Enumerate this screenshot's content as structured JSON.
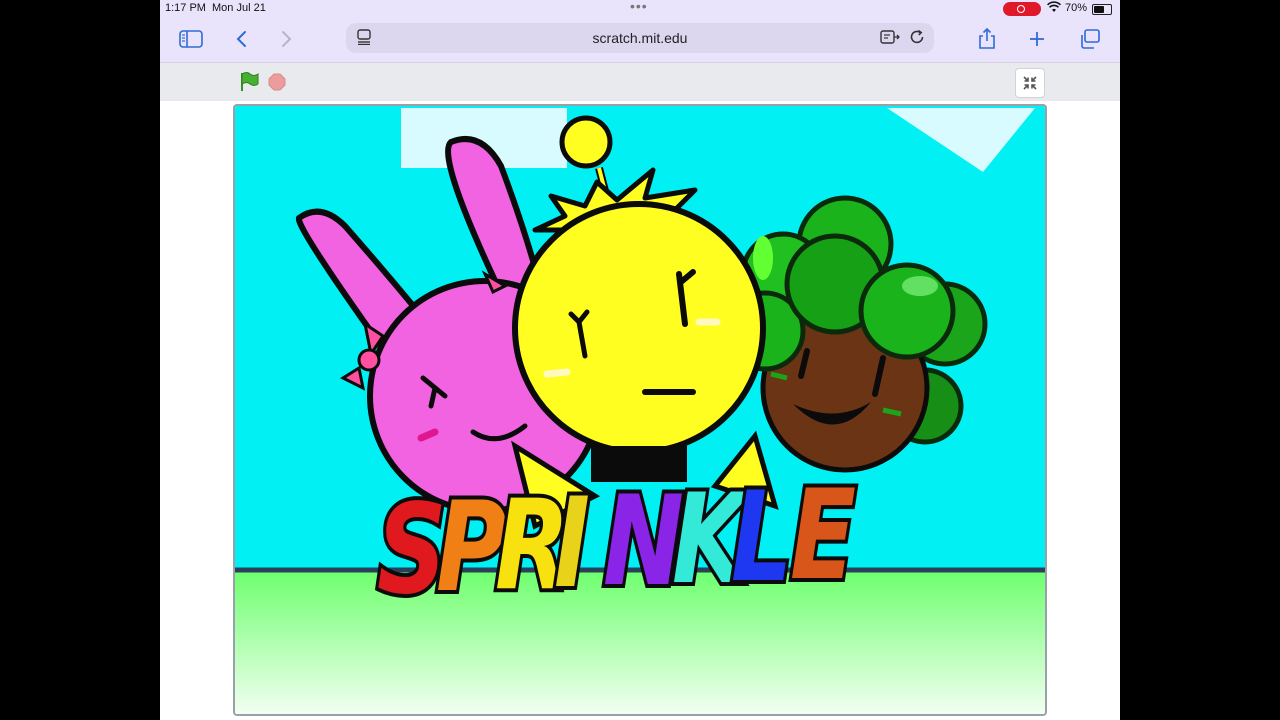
{
  "status_bar": {
    "time": "1:17 PM",
    "date": "Mon Jul 21",
    "battery_percent": "70%",
    "battery_level": 0.7
  },
  "browser": {
    "url": "scratch.mit.edu"
  },
  "stage": {
    "title_text": "SPRINKLE",
    "letter_colors": [
      "#e0191e",
      "#f07f15",
      "#f7e20f",
      "#e8d21a",
      "#8a24e6",
      "#33ead9",
      "#1d38f0",
      "#d9561a",
      "#c572ee"
    ],
    "colors": {
      "sky": "#00f0f3",
      "ground_top": "#6bff6b",
      "ground_bottom": "#f2fff2",
      "pink": "#f163e0",
      "yellow": "#fffe20",
      "green": "#1bb31b",
      "brown": "#6b3414"
    }
  },
  "icons": {
    "sidebar": "sidebar-icon",
    "back": "chevron-left-icon",
    "forward": "chevron-right-icon",
    "tabs": "tab-overview-icon",
    "reader": "reader-icon",
    "reload": "reload-icon",
    "share": "share-icon",
    "new_tab": "plus-icon",
    "all_tabs": "tabs-icon",
    "green_flag": "green-flag-icon",
    "stop": "stop-icon",
    "exit_fullscreen": "exit-fullscreen-icon"
  }
}
